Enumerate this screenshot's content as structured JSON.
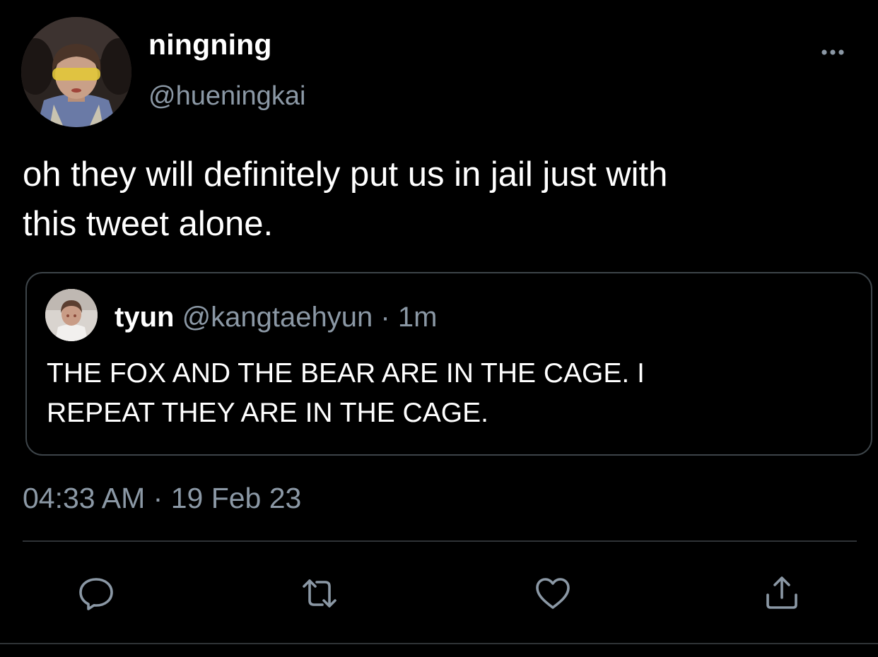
{
  "author": {
    "display_name": "ningning",
    "handle": "@hueningkai",
    "avatar_icon": "profile-photo"
  },
  "tweet": {
    "text": "oh they will definitely put us in jail just with\nthis tweet alone."
  },
  "quoted_tweet": {
    "display_name": "tyun",
    "handle": "@kangtaehyun",
    "separator": "·",
    "time": "1m",
    "text": "THE FOX AND THE BEAR ARE IN THE CAGE. I\nREPEAT THEY ARE IN THE CAGE.",
    "avatar_icon": "profile-photo"
  },
  "meta": {
    "time": "04:33 AM",
    "separator": "·",
    "date": "19 Feb 23"
  },
  "actions": [
    {
      "name": "reply",
      "icon": "speech-bubble-icon"
    },
    {
      "name": "retweet",
      "icon": "retweet-icon"
    },
    {
      "name": "like",
      "icon": "heart-icon"
    },
    {
      "name": "share",
      "icon": "share-icon"
    }
  ],
  "colors": {
    "background": "#000000",
    "primary_text": "#ffffff",
    "secondary_text": "#8b98a5",
    "border": "#3d4449",
    "icon": "#8b98a5"
  }
}
